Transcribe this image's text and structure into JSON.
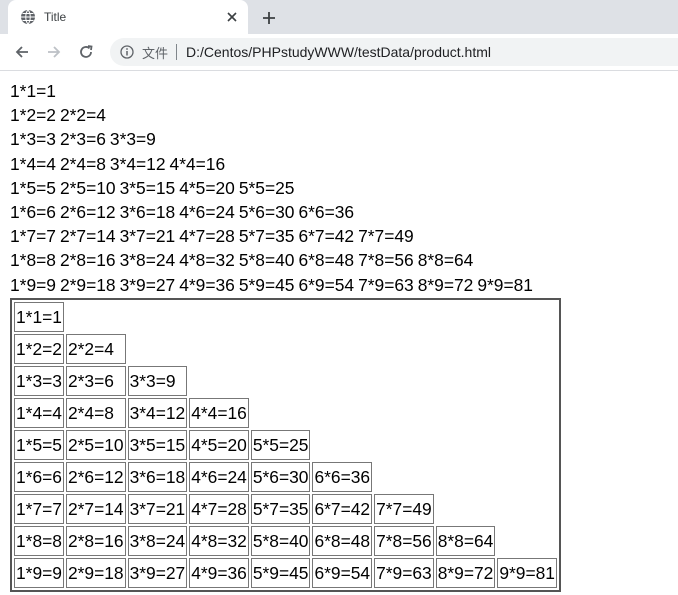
{
  "tab": {
    "title": "Title",
    "favicon": "globe-icon"
  },
  "toolbar": {
    "scheme_label": "文件",
    "url": "D:/Centos/PHPstudyWWW/testData/product.html"
  },
  "text_lines": [
    [
      "1*1=1"
    ],
    [
      "1*2=2",
      "2*2=4"
    ],
    [
      "1*3=3",
      "2*3=6",
      "3*3=9"
    ],
    [
      "1*4=4",
      "2*4=8",
      "3*4=12",
      "4*4=16"
    ],
    [
      "1*5=5",
      "2*5=10",
      "3*5=15",
      "4*5=20",
      "5*5=25"
    ],
    [
      "1*6=6",
      "2*6=12",
      "3*6=18",
      "4*6=24",
      "5*6=30",
      "6*6=36"
    ],
    [
      "1*7=7",
      "2*7=14",
      "3*7=21",
      "4*7=28",
      "5*7=35",
      "6*7=42",
      "7*7=49"
    ],
    [
      "1*8=8",
      "2*8=16",
      "3*8=24",
      "4*8=32",
      "5*8=40",
      "6*8=48",
      "7*8=56",
      "8*8=64"
    ],
    [
      "1*9=9",
      "2*9=18",
      "3*9=27",
      "4*9=36",
      "5*9=45",
      "6*9=54",
      "7*9=63",
      "8*9=72",
      "9*9=81"
    ]
  ],
  "table_rows": [
    [
      "1*1=1"
    ],
    [
      "1*2=2",
      "2*2=4"
    ],
    [
      "1*3=3",
      "2*3=6",
      "3*3=9"
    ],
    [
      "1*4=4",
      "2*4=8",
      "3*4=12",
      "4*4=16"
    ],
    [
      "1*5=5",
      "2*5=10",
      "3*5=15",
      "4*5=20",
      "5*5=25"
    ],
    [
      "1*6=6",
      "2*6=12",
      "3*6=18",
      "4*6=24",
      "5*6=30",
      "6*6=36"
    ],
    [
      "1*7=7",
      "2*7=14",
      "3*7=21",
      "4*7=28",
      "5*7=35",
      "6*7=42",
      "7*7=49"
    ],
    [
      "1*8=8",
      "2*8=16",
      "3*8=24",
      "4*8=32",
      "5*8=40",
      "6*8=48",
      "7*8=56",
      "8*8=64"
    ],
    [
      "1*9=9",
      "2*9=18",
      "3*9=27",
      "4*9=36",
      "5*9=45",
      "6*9=54",
      "7*9=63",
      "8*9=72",
      "9*9=81"
    ]
  ]
}
